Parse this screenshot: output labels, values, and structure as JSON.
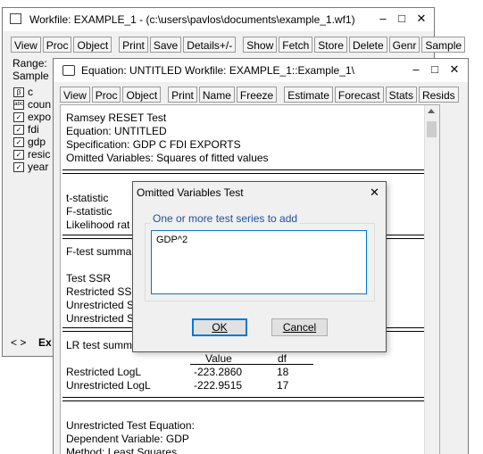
{
  "workfile": {
    "title": "Workfile: EXAMPLE_1 - (c:\\users\\pavlos\\documents\\example_1.wf1)",
    "toolbar": [
      "View",
      "Proc",
      "Object",
      "Print",
      "Save",
      "Details+/-",
      "Show",
      "Fetch",
      "Store",
      "Delete",
      "Genr",
      "Sample"
    ],
    "range_label": "Range:",
    "sample_label": "Sample",
    "objects": [
      {
        "icon": "β",
        "name": "c"
      },
      {
        "icon": "abc",
        "name": "coun"
      },
      {
        "icon": "✓",
        "name": "expo"
      },
      {
        "icon": "✓",
        "name": "fdi"
      },
      {
        "icon": "✓",
        "name": "gdp"
      },
      {
        "icon": "✓",
        "name": "resic"
      },
      {
        "icon": "✓",
        "name": "year"
      }
    ],
    "nav_arrows": "< >",
    "tab": "Ex"
  },
  "equation": {
    "title": "Equation: UNTITLED   Workfile: EXAMPLE_1::Example_1\\",
    "toolbar": [
      "View",
      "Proc",
      "Object",
      "Print",
      "Name",
      "Freeze",
      "Estimate",
      "Forecast",
      "Stats",
      "Resids"
    ],
    "output": {
      "heading": "Ramsey RESET Test",
      "equation": "Equation: UNTITLED",
      "specification": "Specification: GDP C FDI EXPORTS",
      "omitted": "Omitted Variables: Squares of fitted values",
      "tstat": "t-statistic",
      "fstat": "F-statistic",
      "lr": "Likelihood rat",
      "ftest_summary": "F-test summa",
      "test_ssr": "Test SSR",
      "restricted_ss": "Restricted SS",
      "unrestricted_s1": "Unrestricted S",
      "unrestricted_s2": "Unrestricted S",
      "lr_summary": "LR test summ",
      "col_value": "Value",
      "col_df": "df",
      "rows": [
        {
          "label": "Restricted LogL",
          "value": "-223.2860",
          "df": "18"
        },
        {
          "label": "Unrestricted LogL",
          "value": "-222.9515",
          "df": "17"
        }
      ],
      "unres_eq": "Unrestricted Test Equation:",
      "dep_var": "Dependent Variable: GDP",
      "method": "Method: Least Squares"
    }
  },
  "dialog": {
    "title": "Omitted Variables Test",
    "group_label": "One or more test series to add",
    "input_value": "GDP^2",
    "ok": "OK",
    "cancel": "Cancel"
  },
  "controls": {
    "minimize": "–",
    "maximize": "□",
    "close": "✕"
  }
}
